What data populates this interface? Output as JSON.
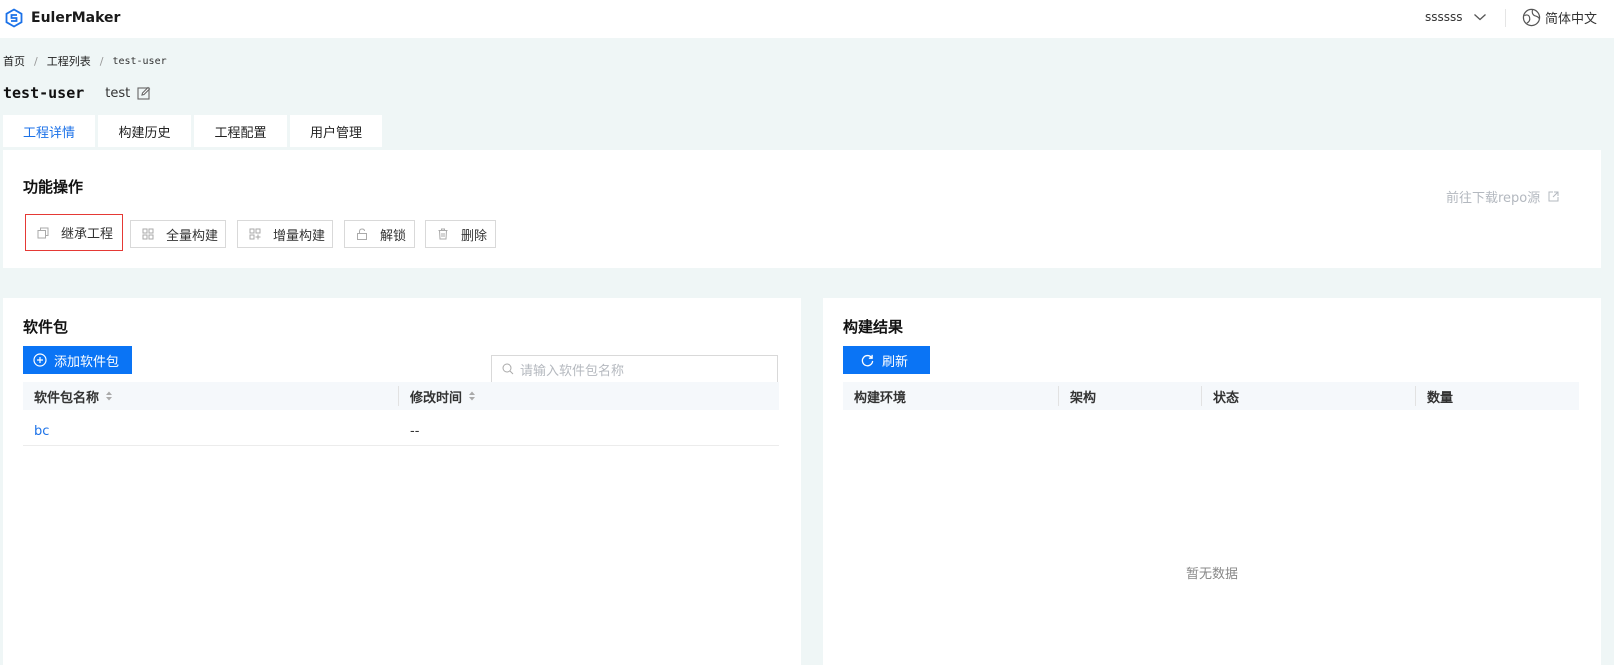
{
  "app": {
    "name": "EulerMaker"
  },
  "header": {
    "username": "ssssss",
    "language": "简体中文"
  },
  "breadcrumb": {
    "home": "首页",
    "list": "工程列表",
    "current": "test-user"
  },
  "project": {
    "name": "test-user",
    "description": "test"
  },
  "tabs": [
    {
      "label": "工程详情",
      "active": true
    },
    {
      "label": "构建历史"
    },
    {
      "label": "工程配置"
    },
    {
      "label": "用户管理"
    }
  ],
  "operations": {
    "title": "功能操作",
    "repo_link": "前往下载repo源",
    "buttons": {
      "inherit": "继承工程",
      "full_build": "全量构建",
      "incr_build": "增量构建",
      "unlock": "解锁",
      "delete": "删除"
    }
  },
  "packages": {
    "title": "软件包",
    "add_button": "添加软件包",
    "search_placeholder": "请输入软件包名称",
    "columns": {
      "name": "软件包名称",
      "modified": "修改时间"
    },
    "rows": [
      {
        "name": "bc",
        "modified": "--"
      }
    ]
  },
  "results": {
    "title": "构建结果",
    "refresh_button": "刷新",
    "columns": {
      "env": "构建环境",
      "arch": "架构",
      "status": "状态",
      "count": "数量"
    },
    "empty_text": "暂无数据"
  },
  "colors": {
    "primary": "#0a74f5",
    "active_tab": "#1c72e8",
    "highlight_border": "#e53935",
    "background": "#eff6f6"
  }
}
